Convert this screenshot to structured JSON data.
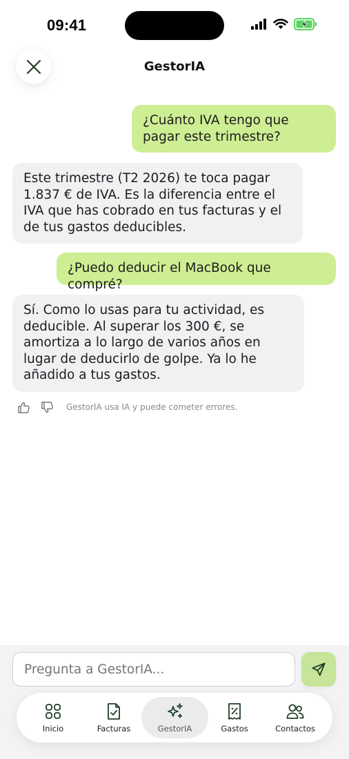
{
  "status_bar": {
    "time": "09:41"
  },
  "header": {
    "title": "GestorIA"
  },
  "messages": [
    {
      "role": "user",
      "text": "¿Cuánto IVA tengo que pagar este trimestre?"
    },
    {
      "role": "assistant",
      "text": "Este trimestre (T2 2026) te toca pagar 1.837 € de IVA. Es la diferencia entre el IVA que has cobrado en tus facturas y el de tus gastos deducibles."
    },
    {
      "role": "user",
      "text": "¿Puedo deducir el MacBook que compré?"
    },
    {
      "role": "assistant",
      "text": "Sí. Como lo usas para tu actividad, es deducible. Al superar los 300 €, se amortiza a lo largo de varios años en lugar de deducirlo de golpe. Ya lo he añadido a tus gastos."
    }
  ],
  "disclaimer": "GestorIA usa IA y puede cometer errores.",
  "composer": {
    "placeholder": "Pregunta a GestorIA..."
  },
  "tabs": [
    {
      "label": "Inicio",
      "icon": "grid-icon"
    },
    {
      "label": "Facturas",
      "icon": "invoice-check-icon"
    },
    {
      "label": "GestorIA",
      "icon": "sparkles-icon",
      "active": true
    },
    {
      "label": "Gastos",
      "icon": "receipt-percent-icon"
    },
    {
      "label": "Contactos",
      "icon": "users-icon"
    }
  ],
  "colors": {
    "user_bubble": "#cdee92",
    "assistant_bubble": "#f1f1f4",
    "send_button": "#c6e59a",
    "battery": "#5bd45f",
    "icon_dark": "#1f3d24"
  }
}
